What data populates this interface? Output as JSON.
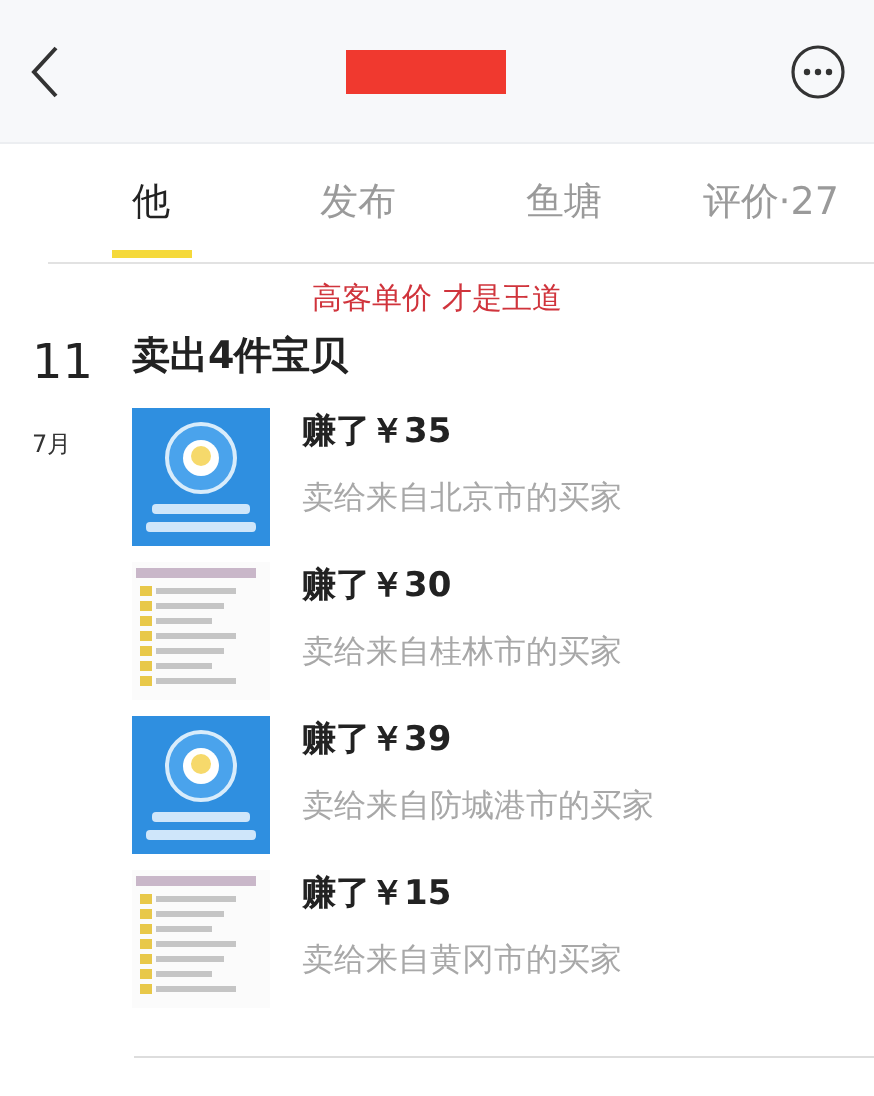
{
  "header": {
    "title_redacted": true
  },
  "tabs": [
    {
      "label": "他",
      "selected": true
    },
    {
      "label": "发布",
      "selected": false
    },
    {
      "label": "鱼塘",
      "selected": false
    },
    {
      "label": "评价·27",
      "selected": false
    }
  ],
  "annotation": "高客单价 才是王道",
  "entry": {
    "day": "11",
    "month": "7月",
    "title": "卖出4件宝贝",
    "items": [
      {
        "kind": "picture",
        "earned": "赚了￥35",
        "buyer": "卖给来自北京市的买家"
      },
      {
        "kind": "picture",
        "earned": "赚了￥30",
        "buyer": "卖给来自桂林市的买家"
      },
      {
        "kind": "picture",
        "earned": "赚了￥39",
        "buyer": "卖给来自防城港市的买家"
      },
      {
        "kind": "picture",
        "earned": "赚了￥15",
        "buyer": "卖给来自黄冈市的买家"
      }
    ]
  }
}
